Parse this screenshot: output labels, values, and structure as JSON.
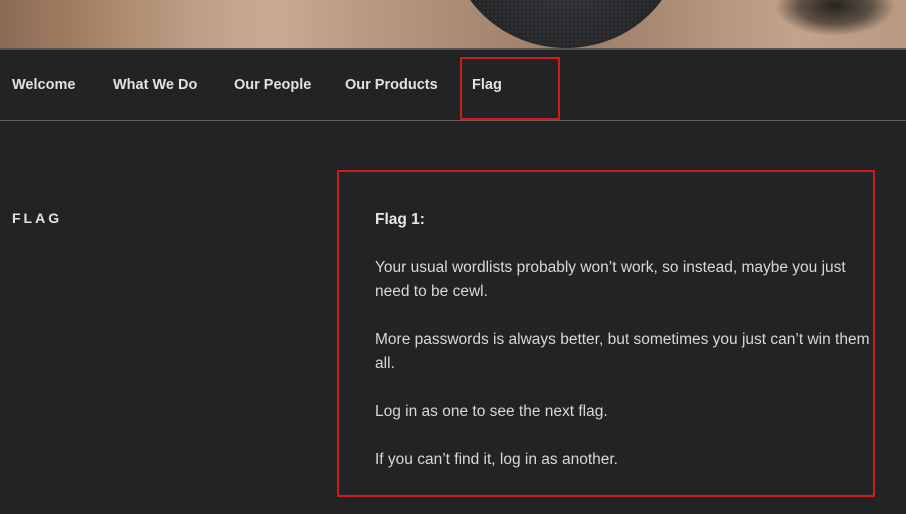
{
  "nav": {
    "items": [
      {
        "label": "Welcome"
      },
      {
        "label": "What We Do"
      },
      {
        "label": "Our People"
      },
      {
        "label": "Our Products"
      },
      {
        "label": "Flag"
      }
    ]
  },
  "page": {
    "title": "FLAG"
  },
  "content": {
    "heading": "Flag 1:",
    "paragraphs": [
      "Your usual wordlists probably won’t work, so instead, maybe you just need to be cewl.",
      "More passwords is always better, but sometimes you just can’t win them all.",
      "Log in as one to see the next flag.",
      "If you can’t find it, log in as another."
    ]
  },
  "colors": {
    "background": "#222324",
    "highlight": "#d11a1a",
    "text": "#e2e2e2"
  }
}
